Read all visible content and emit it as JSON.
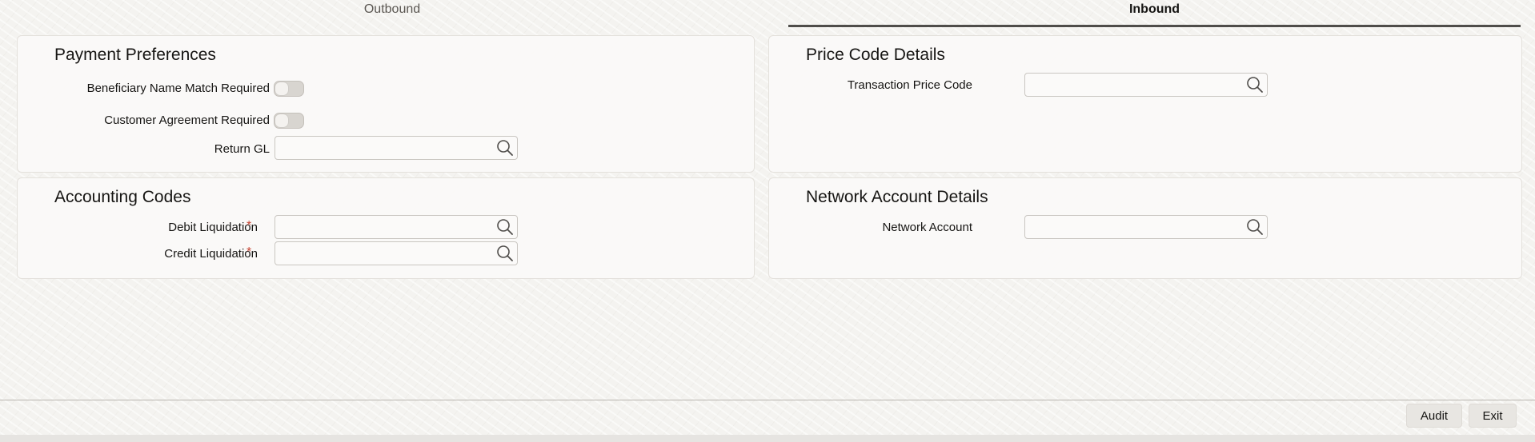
{
  "tabs": {
    "outbound": "Outbound",
    "inbound": "Inbound",
    "active": "Inbound"
  },
  "payment_preferences": {
    "title": "Payment Preferences",
    "beneficiary_name_match_label": "Beneficiary Name Match Required",
    "beneficiary_name_match_value": false,
    "customer_agreement_label": "Customer Agreement Required",
    "customer_agreement_value": false,
    "return_gl_label": "Return GL",
    "return_gl_value": ""
  },
  "accounting_codes": {
    "title": "Accounting Codes",
    "debit_liquidation_label": "Debit Liquidation",
    "debit_liquidation_value": "",
    "credit_liquidation_label": "Credit Liquidation",
    "credit_liquidation_value": "",
    "required_marker": "*"
  },
  "price_code_details": {
    "title": "Price Code Details",
    "transaction_price_code_label": "Transaction Price Code",
    "transaction_price_code_value": ""
  },
  "network_account_details": {
    "title": "Network Account Details",
    "network_account_label": "Network Account",
    "network_account_value": ""
  },
  "footer": {
    "audit_label": "Audit",
    "exit_label": "Exit"
  },
  "icons": {
    "search": "search-icon"
  },
  "colors": {
    "required": "#c74634",
    "active_tab_underline": "#4f4d4a",
    "toggle_off": "#d8d5d0"
  }
}
